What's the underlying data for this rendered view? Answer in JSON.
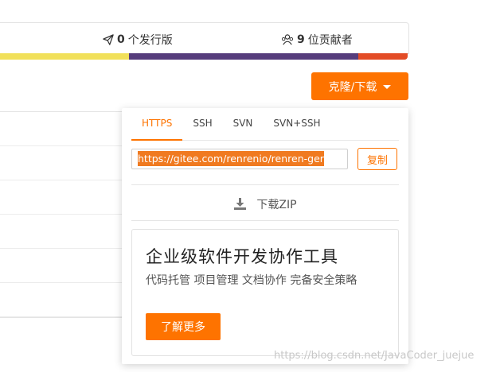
{
  "stats": {
    "releases": {
      "icon": "send-icon",
      "count": "0",
      "label": "个发行版"
    },
    "contributors": {
      "icon": "users-icon",
      "count": "9",
      "label": "位贡献者"
    }
  },
  "language_bar": [
    {
      "color": "#f1e05a",
      "share": 32
    },
    {
      "color": "#563d7c",
      "share": 56
    },
    {
      "color": "#e34c26",
      "share": 12
    }
  ],
  "clone_button": {
    "label": "克隆/下载",
    "color": "#fe7300"
  },
  "clone_popup": {
    "tabs": [
      {
        "label": "HTTPS",
        "active": true
      },
      {
        "label": "SSH",
        "active": false
      },
      {
        "label": "SVN",
        "active": false
      },
      {
        "label": "SVN+SSH",
        "active": false
      }
    ],
    "url_value": "https://gitee.com/renrenio/renren-ger",
    "copy_label": "复制",
    "download_label": "下载ZIP",
    "promo": {
      "title": "企业级软件开发协作工具",
      "subtitle": "代码托管 项目管理 文档协作 完备安全策略",
      "button_label": "了解更多"
    }
  },
  "watermark": "https://blog.csdn.net/JavaCoder_juejue"
}
